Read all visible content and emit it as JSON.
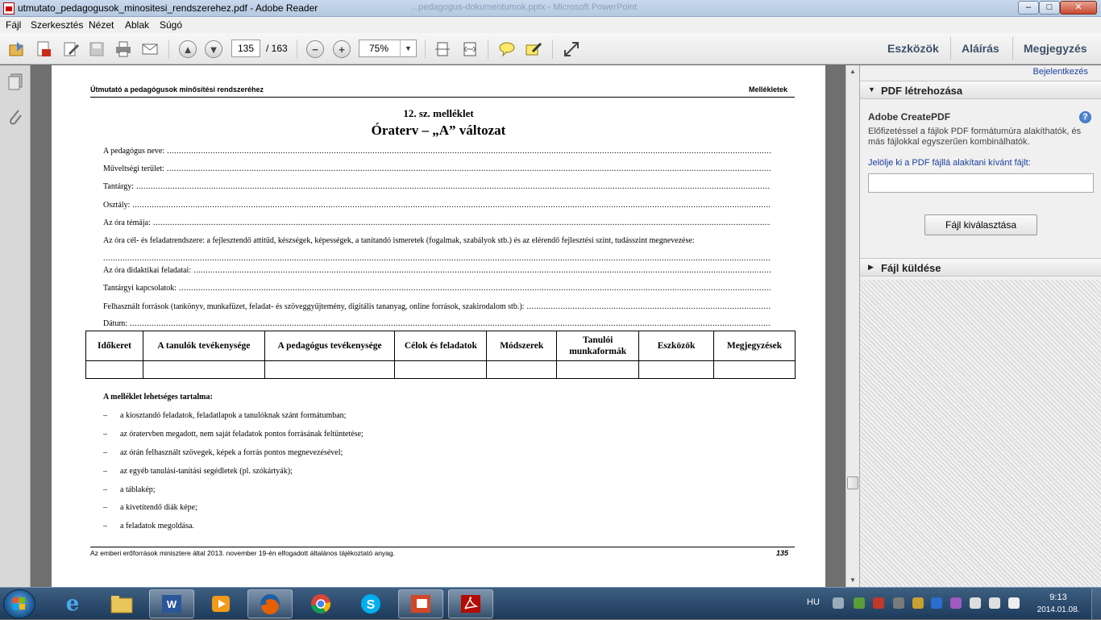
{
  "window": {
    "title": "utmutato_pedagogusok_minositesi_rendszerehez.pdf - Adobe Reader",
    "ghost_title": "...pedagogus-dokumentumok.pptx - Microsoft PowerPoint",
    "min": "–",
    "max": "□",
    "close": "✕"
  },
  "menu": [
    "Fájl",
    "Szerkesztés",
    "Nézet",
    "Ablak",
    "Súgó"
  ],
  "toolbar": {
    "page_current": "135",
    "page_total": "/ 163",
    "zoom": "75%"
  },
  "right_tools": {
    "tools": "Eszközök",
    "sign": "Aláírás",
    "comment": "Megjegyzés"
  },
  "panel": {
    "login": "Bejelentkezés",
    "section1_title": "PDF létrehozása",
    "service_name": "Adobe CreatePDF",
    "service_desc": "Előfizetéssel a fájlok PDF formátumúra alakíthatók, és más fájlokkal egyszerűen kombinálhatók.",
    "select_prompt": "Jelölje ki a PDF fájllá alakítani kívánt fájlt:",
    "input_value": "",
    "choose_button": "Fájl kiválasztása",
    "section2_title": "Fájl küldése"
  },
  "pdf": {
    "header_left": "Útmutató a pedagógusok minősítési rendszeréhez",
    "header_right": "Mellékletek",
    "annex_no": "12. sz. melléklet",
    "title": "Óraterv – „A” változat",
    "fields": [
      "A pedagógus neve:",
      "Műveltségi terület:",
      "Tantárgy:",
      "Osztály:",
      "Az óra témája:",
      "Az óra cél- és feladatrendszere: a fejlesztendő attitűd, készségek, képességek, a tanítandó ismeretek (fogalmak, szabályok stb.) és az elérendő fejlesztési szint, tudásszint megnevezése:",
      "",
      "Az óra didaktikai feladatai:",
      "Tantárgyi kapcsolatok:",
      "Felhasznált források (tankönyv, munkafüzet, feladat- és szöveggyűjtemény, digitális tananyag, online források, szakirodalom stb.):",
      "Dátum:"
    ],
    "table_headers": [
      "Időkeret",
      "A tanulók tevékenysége",
      "A pedagógus tevékenysége",
      "Célok és feladatok",
      "Módszerek",
      "Tanulói munkaformák",
      "Eszközök",
      "Megjegyzések"
    ],
    "content_title": "A melléklet lehetséges tartalma:",
    "list_dash": "–",
    "list": [
      "a kiosztandó feladatok, feladatlapok a tanulóknak szánt formátumban;",
      "az óratervben megadott, nem saját feladatok pontos forrásának feltüntetése;",
      "az órán felhasznált szövegek, képek a forrás pontos megnevezésével;",
      "az egyéb tanulási-tanítási segédletek (pl. szókártyák);",
      "a táblakép;",
      "a kivetítendő diák képe;",
      "a feladatok megoldása."
    ],
    "footer_left": "Az emberi erőforrások minisztere által 2013. november 19-én elfogadott általános tájékoztató anyag.",
    "footer_right": "135"
  },
  "taskbar": {
    "lang": "HU",
    "time": "9:13",
    "date": "2014.01.08."
  },
  "colors": {
    "accent": "#3d5068",
    "link": "#1a3f9c",
    "taskbar": "#1d3a5a"
  }
}
